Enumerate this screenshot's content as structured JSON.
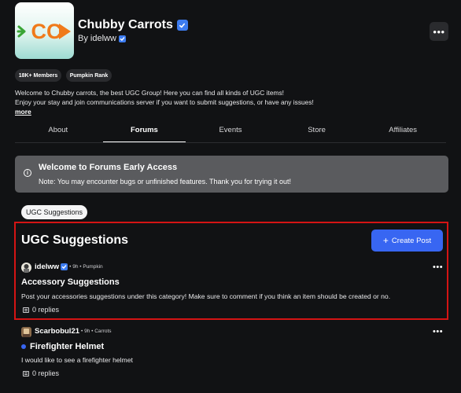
{
  "group": {
    "logo_text": "CC",
    "name": "Chubby Carrots",
    "byline": "By idelww",
    "more_icon": "•••",
    "badges": [
      "18K+ Members",
      "Pumpkin Rank"
    ],
    "description_line1": "Welcome to Chubby carrots, the best UGC Group! Here you can find all kinds of UGC items!",
    "description_line2": "Enjoy your stay and join communications server if you want to submit suggestions, or have any issues!",
    "more_link": "more"
  },
  "tabs": [
    {
      "label": "About",
      "active": false
    },
    {
      "label": "Forums",
      "active": true
    },
    {
      "label": "Events",
      "active": false
    },
    {
      "label": "Store",
      "active": false
    },
    {
      "label": "Affiliates",
      "active": false
    }
  ],
  "banner": {
    "title": "Welcome to Forums Early Access",
    "text": "Note: You may encounter bugs or unfinished features. Thank you for trying it out!"
  },
  "breadcrumb": "UGC Suggestions",
  "category": {
    "title": "UGC Suggestions",
    "create_button": "Create Post"
  },
  "posts": [
    {
      "author": "idelww",
      "verified": true,
      "meta": "• 9h • Pumpkin",
      "title": "Accessory Suggestions",
      "body": "Post your accessories suggestions under this category! Make sure to comment if you think an item should be created or no.",
      "replies": "0 replies",
      "unread": false
    },
    {
      "author": "Scarbobul21",
      "verified": false,
      "meta": "• 9h • Carrots",
      "title": "Firefighter Helmet",
      "body": "I would like to see a firefighter helmet",
      "replies": "0 replies",
      "unread": true
    }
  ],
  "colors": {
    "background": "#111214",
    "accent": "#3866f2",
    "verified": "#3d7cf0",
    "highlight_border": "#d41414",
    "logo_orange": "#f07a1a",
    "logo_green": "#3aa535"
  }
}
